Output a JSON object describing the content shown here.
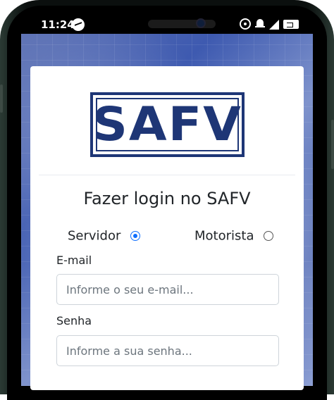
{
  "status_bar": {
    "time": "11:24",
    "icons": [
      "messenger-icon",
      "hotspot-icon",
      "notification-bell-icon",
      "signal-icon",
      "battery-icon"
    ]
  },
  "brand": {
    "logo_text": "SAFV",
    "logo_color": "#1e3676"
  },
  "login": {
    "title": "Fazer login no SAFV",
    "role_options": [
      {
        "label": "Servidor",
        "checked": true
      },
      {
        "label": "Motorista",
        "checked": false
      }
    ],
    "email": {
      "label": "E-mail",
      "placeholder": "Informe o seu e-mail...",
      "value": ""
    },
    "password": {
      "label": "Senha",
      "placeholder": "Informe a sua senha...",
      "value": ""
    }
  },
  "colors": {
    "accent": "#0d6efd"
  }
}
